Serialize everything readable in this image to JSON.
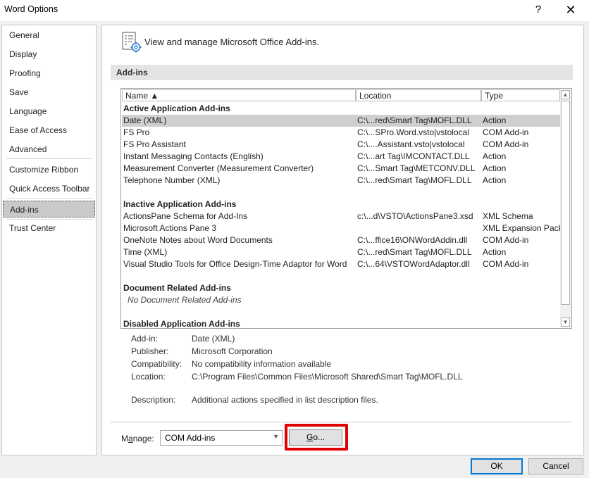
{
  "window": {
    "title": "Word Options",
    "help_glyph": "?",
    "close_glyph": "✕"
  },
  "sidebar": {
    "items": [
      {
        "label": "General"
      },
      {
        "label": "Display"
      },
      {
        "label": "Proofing"
      },
      {
        "label": "Save"
      },
      {
        "label": "Language"
      },
      {
        "label": "Ease of Access"
      },
      {
        "label": "Advanced"
      },
      {
        "label": "Customize Ribbon"
      },
      {
        "label": "Quick Access Toolbar"
      },
      {
        "label": "Add-ins",
        "selected": true
      },
      {
        "label": "Trust Center"
      }
    ]
  },
  "main": {
    "header": "View and manage Microsoft Office Add-ins.",
    "section_title": "Add-ins",
    "columns": {
      "name": "Name ▲",
      "location": "Location",
      "type": "Type"
    },
    "groups": {
      "active": {
        "title": "Active Application Add-ins",
        "rows": [
          {
            "name": "Date (XML)",
            "location": "C:\\...red\\Smart Tag\\MOFL.DLL",
            "type": "Action"
          },
          {
            "name": "FS Pro",
            "location": "C:\\...SPro.Word.vsto|vstolocal",
            "type": "COM Add-in"
          },
          {
            "name": "FS Pro Assistant",
            "location": "C:\\....Assistant.vsto|vstolocal",
            "type": "COM Add-in"
          },
          {
            "name": "Instant Messaging Contacts (English)",
            "location": "C:\\...art Tag\\IMCONTACT.DLL",
            "type": "Action"
          },
          {
            "name": "Measurement Converter (Measurement Converter)",
            "location": "C:\\...Smart Tag\\METCONV.DLL",
            "type": "Action"
          },
          {
            "name": "Telephone Number (XML)",
            "location": "C:\\...red\\Smart Tag\\MOFL.DLL",
            "type": "Action"
          }
        ]
      },
      "inactive": {
        "title": "Inactive Application Add-ins",
        "rows": [
          {
            "name": "ActionsPane Schema for Add-Ins",
            "location": "c:\\...d\\VSTO\\ActionsPane3.xsd",
            "type": "XML Schema"
          },
          {
            "name": "Microsoft Actions Pane 3",
            "location": "",
            "type": "XML Expansion Pack"
          },
          {
            "name": "OneNote Notes about Word Documents",
            "location": "C:\\...ffice16\\ONWordAddin.dll",
            "type": "COM Add-in"
          },
          {
            "name": "Time (XML)",
            "location": "C:\\...red\\Smart Tag\\MOFL.DLL",
            "type": "Action"
          },
          {
            "name": "Visual Studio Tools for Office Design-Time Adaptor for Word",
            "location": "C:\\...64\\VSTOWordAdaptor.dll",
            "type": "COM Add-in"
          }
        ]
      },
      "document": {
        "title": "Document Related Add-ins",
        "empty_text": "No Document Related Add-ins"
      },
      "disabled": {
        "title": "Disabled Application Add-ins"
      }
    },
    "details": {
      "addin_label": "Add-in:",
      "addin": "Date (XML)",
      "publisher_label": "Publisher:",
      "publisher": "Microsoft Corporation",
      "compat_label": "Compatibility:",
      "compat": "No compatibility information available",
      "location_label": "Location:",
      "location": "C:\\Program Files\\Common Files\\Microsoft Shared\\Smart Tag\\MOFL.DLL",
      "desc_label": "Description:",
      "desc": "Additional actions specified in list description files."
    },
    "manage": {
      "label_pre": "M",
      "label_u": "a",
      "label_post": "nage:",
      "value": "COM Add-ins",
      "go_u": "G",
      "go_post": "o..."
    }
  },
  "footer": {
    "ok": "OK",
    "cancel": "Cancel"
  },
  "colors": {
    "highlight": "#e00000",
    "accent": "#0078d7"
  }
}
